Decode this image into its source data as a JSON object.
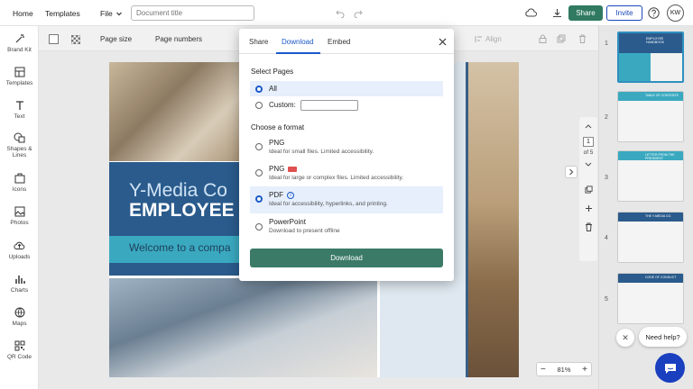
{
  "topbar": {
    "home": "Home",
    "templates": "Templates",
    "file": "File",
    "doc_title_placeholder": "Document title",
    "share": "Share",
    "invite": "Invite",
    "avatar_initials": "KW"
  },
  "toolbar": {
    "page_size": "Page size",
    "page_numbers": "Page numbers",
    "align": "Align"
  },
  "sidebar": {
    "items": [
      {
        "label": "Brand Kit",
        "icon": "wand-icon"
      },
      {
        "label": "Templates",
        "icon": "templates-icon"
      },
      {
        "label": "Text",
        "icon": "text-icon"
      },
      {
        "label": "Shapes & Lines",
        "icon": "shapes-icon"
      },
      {
        "label": "Icons",
        "icon": "icons-icon"
      },
      {
        "label": "Photos",
        "icon": "photos-icon"
      },
      {
        "label": "Uploads",
        "icon": "upload-icon"
      },
      {
        "label": "Charts",
        "icon": "charts-icon"
      },
      {
        "label": "Maps",
        "icon": "maps-icon"
      },
      {
        "label": "QR Code",
        "icon": "qr-icon"
      }
    ]
  },
  "canvas": {
    "title_line1": "Y-Media Co",
    "title_line2": "EMPLOYEE",
    "subtitle": "Welcome to a compa",
    "page_current": "1",
    "page_of": "of 5",
    "zoom": "81%"
  },
  "thumbnails": {
    "items": [
      {
        "num": "1",
        "caption": "EMPLOYEE HANDBOOK"
      },
      {
        "num": "2",
        "caption": "TABLE OF CONTENTS"
      },
      {
        "num": "3",
        "caption": "LETTER FROM THE PRESIDENT"
      },
      {
        "num": "4",
        "caption": "THE Y-MEDIA CO."
      },
      {
        "num": "5",
        "caption": "CODE OF CONDUCT"
      }
    ]
  },
  "modal": {
    "tabs": [
      "Share",
      "Download",
      "Embed"
    ],
    "active_tab": "Download",
    "select_pages": "Select Pages",
    "all": "All",
    "custom": "Custom:",
    "choose_format": "Choose a format",
    "formats": [
      {
        "title": "PNG",
        "desc": "Ideal for small files. Limited accessibility."
      },
      {
        "title": "PNG",
        "desc": "Ideal for large or complex files. Limited accessibility."
      },
      {
        "title": "PDF",
        "desc": "Ideal for accessibility, hyperlinks, and printing."
      },
      {
        "title": "PowerPoint",
        "desc": "Download to present offline"
      }
    ],
    "download": "Download"
  },
  "help": {
    "label": "Need help?"
  },
  "colors": {
    "accent": "#1a5ac9",
    "share_button": "#2f7a61",
    "download_button": "#3a7a66",
    "chat_button": "#1a3fbf"
  }
}
